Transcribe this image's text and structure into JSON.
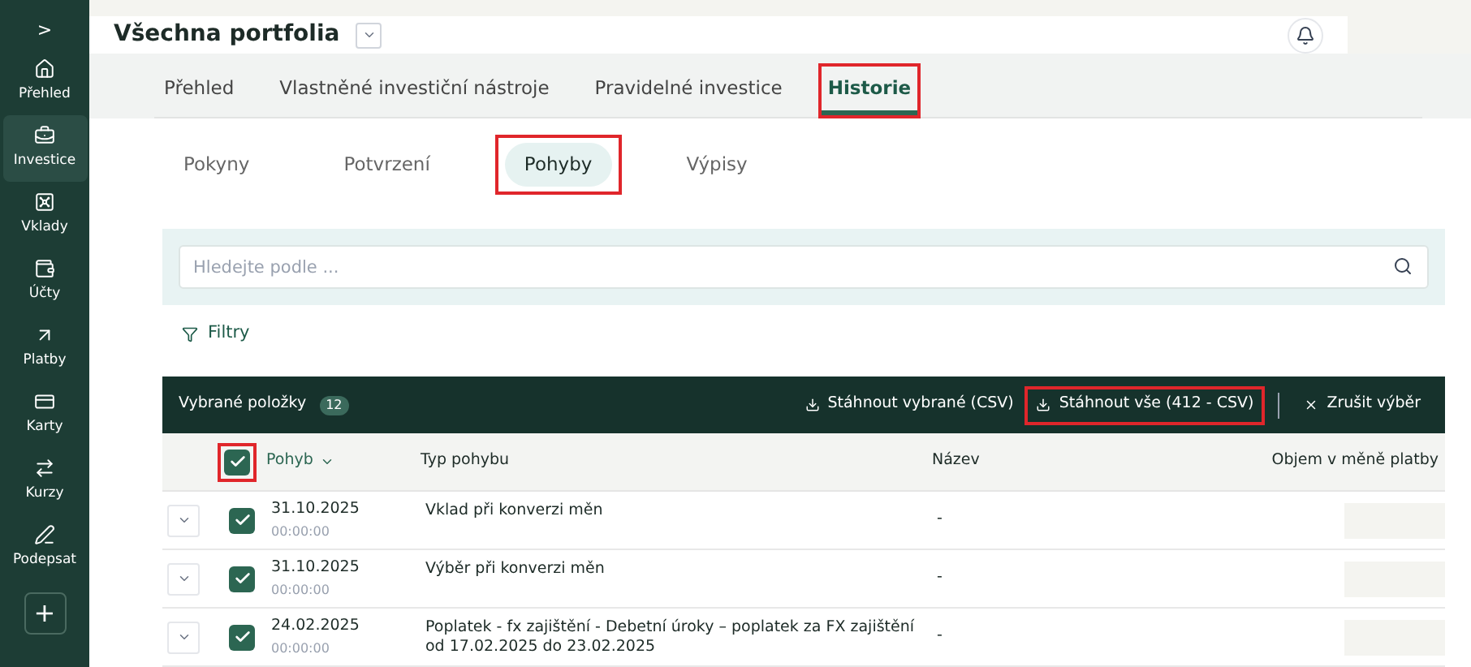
{
  "sidebar": {
    "toggle": ">",
    "items": [
      {
        "kind": "home",
        "label": "Přehled",
        "selected": false
      },
      {
        "kind": "briefcase",
        "label": "Investice",
        "selected": true
      },
      {
        "kind": "safe",
        "label": "Vklady",
        "selected": false
      },
      {
        "kind": "wallet",
        "label": "Účty",
        "selected": false
      },
      {
        "kind": "arrow",
        "label": "Platby",
        "selected": false
      },
      {
        "kind": "card",
        "label": "Karty",
        "selected": false
      },
      {
        "kind": "exchange",
        "label": "Kurzy",
        "selected": false
      },
      {
        "kind": "pen",
        "label": "Podepsat",
        "selected": false
      }
    ],
    "add_button": "+"
  },
  "header": {
    "title": "Všechna portfolia"
  },
  "tabs": [
    {
      "label": "Přehled",
      "selected": false,
      "highlighted": false
    },
    {
      "label": "Vlastněné investiční nástroje",
      "selected": false,
      "highlighted": false
    },
    {
      "label": "Pravidelné investice",
      "selected": false,
      "highlighted": false
    },
    {
      "label": "Historie",
      "selected": true,
      "highlighted": true
    }
  ],
  "subtabs": [
    {
      "label": "Pokyny",
      "selected": false,
      "highlighted": false
    },
    {
      "label": "Potvrzení",
      "selected": false,
      "highlighted": false
    },
    {
      "label": "Pohyby",
      "selected": true,
      "highlighted": true
    },
    {
      "label": "Výpisy",
      "selected": false,
      "highlighted": false
    }
  ],
  "search": {
    "placeholder": "Hledejte podle ..."
  },
  "filters_link": "Filtry",
  "selection_bar": {
    "label": "Vybrané položky",
    "count": "12",
    "actions": [
      {
        "kind": "download",
        "label": "Stáhnout vybrané (CSV)",
        "highlighted": false
      },
      {
        "kind": "download",
        "label": "Stáhnout vše (412 - CSV)",
        "highlighted": true
      },
      {
        "kind": "cancel",
        "label": "Zrušit výběr",
        "highlighted": false
      }
    ]
  },
  "table": {
    "select_all": {
      "checked": true,
      "highlighted": true
    },
    "columns": [
      "Pohyb",
      "Typ pohybu",
      "Název",
      "Objem v měně platby"
    ],
    "rows": [
      {
        "checked": true,
        "date": "31.10.2025",
        "time": "00:00:00",
        "type": "Vklad při konverzi měn",
        "name": "-"
      },
      {
        "checked": true,
        "date": "31.10.2025",
        "time": "00:00:00",
        "type": "Výběr při konverzi měn",
        "name": "-"
      },
      {
        "checked": true,
        "date": "24.02.2025",
        "time": "00:00:00",
        "type": "Poplatek - fx zajištění - Debetní úroky – poplatek za FX zajištění od 17.02.2025 do 23.02.2025",
        "name": "-"
      }
    ]
  }
}
